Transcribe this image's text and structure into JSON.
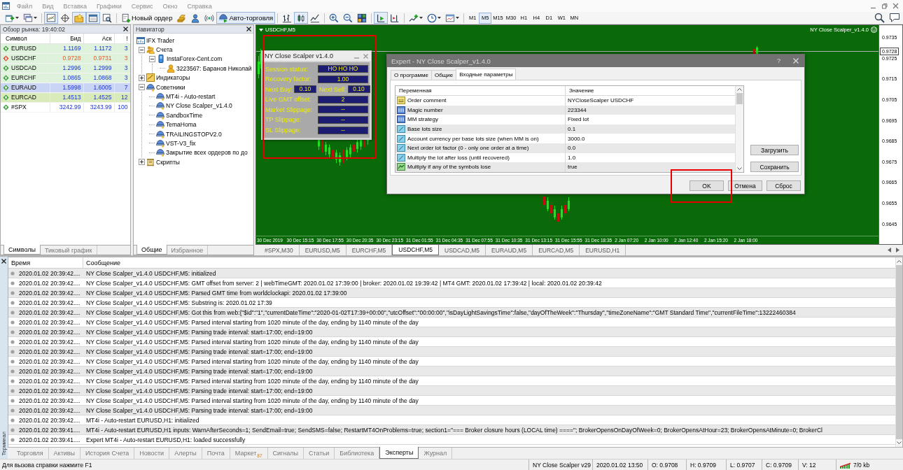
{
  "menu": [
    "Файл",
    "Вид",
    "Вставка",
    "Графики",
    "Сервис",
    "Окно",
    "Справка"
  ],
  "toolbar": {
    "items": [
      {
        "kind": "icon",
        "pressed": false
      },
      {
        "kind": "icon",
        "pressed": false
      },
      {
        "kind": "separator"
      },
      {
        "kind": "icon",
        "pressed": true
      },
      {
        "kind": "icon",
        "pressed": false
      },
      {
        "kind": "icon",
        "pressed": true
      },
      {
        "kind": "icon",
        "pressed": true
      },
      {
        "kind": "icon",
        "pressed": false
      },
      {
        "kind": "separator"
      },
      {
        "kind": "button",
        "label": "Новый ордер"
      },
      {
        "kind": "icon",
        "pressed": false
      },
      {
        "kind": "icon",
        "pressed": false
      },
      {
        "kind": "icon",
        "pressed": false
      },
      {
        "kind": "toggle",
        "label": "Авто-торговля",
        "on": true
      },
      {
        "kind": "separator"
      },
      {
        "kind": "icon",
        "pressed": false
      },
      {
        "kind": "icon",
        "pressed": true
      },
      {
        "kind": "icon",
        "pressed": false
      },
      {
        "kind": "separator"
      },
      {
        "kind": "icon",
        "pressed": false
      },
      {
        "kind": "icon",
        "pressed": false
      },
      {
        "kind": "icon",
        "pressed": false
      },
      {
        "kind": "separator"
      },
      {
        "kind": "icon",
        "pressed": true
      },
      {
        "kind": "icon",
        "pressed": false
      },
      {
        "kind": "separator"
      },
      {
        "kind": "icon",
        "pressed": false
      },
      {
        "kind": "icon",
        "pressed": false
      },
      {
        "kind": "icon",
        "pressed": false
      },
      {
        "kind": "separator"
      },
      {
        "kind": "timeframe",
        "label": "M1",
        "selected": false
      },
      {
        "kind": "timeframe",
        "label": "M5",
        "selected": true
      },
      {
        "kind": "timeframe",
        "label": "M15",
        "selected": false
      },
      {
        "kind": "timeframe",
        "label": "M30",
        "selected": false
      },
      {
        "kind": "timeframe",
        "label": "H1",
        "selected": false
      },
      {
        "kind": "timeframe",
        "label": "H4",
        "selected": false
      },
      {
        "kind": "timeframe",
        "label": "D1",
        "selected": false
      },
      {
        "kind": "timeframe",
        "label": "W1",
        "selected": false
      },
      {
        "kind": "timeframe",
        "label": "MN",
        "selected": false
      }
    ]
  },
  "market_watch": {
    "title": "Обзор рынка: 19:40:02",
    "columns": [
      "Символ",
      "Бид",
      "Аск",
      "!"
    ],
    "rows": [
      {
        "symbol": "EURUSD",
        "bid": "1.1169",
        "ask": "1.1172",
        "spread": "3",
        "falling": false,
        "color": "#dff2dc"
      },
      {
        "symbol": "USDCHF",
        "bid": "0.9728",
        "ask": "0.9731",
        "spread": "3",
        "falling": true,
        "color": "#dff2dc"
      },
      {
        "symbol": "USDCAD",
        "bid": "1.2996",
        "ask": "1.2999",
        "spread": "3",
        "falling": false,
        "color": "#dff2dc"
      },
      {
        "symbol": "EURCHF",
        "bid": "1.0865",
        "ask": "1.0868",
        "spread": "3",
        "falling": false,
        "color": "#dff2dc"
      },
      {
        "symbol": "EURAUD",
        "bid": "1.5998",
        "ask": "1.6005",
        "spread": "7",
        "falling": false,
        "color": "#cad4f5"
      },
      {
        "symbol": "EURCAD",
        "bid": "1.4513",
        "ask": "1.4525",
        "spread": "12",
        "falling": false,
        "color": "#d9eabb"
      },
      {
        "symbol": "#SPX",
        "bid": "3242.99",
        "ask": "3243.99",
        "spread": "100",
        "falling": false,
        "color": "#ffffff"
      }
    ],
    "tabs": [
      {
        "label": "Символы",
        "selected": true
      },
      {
        "label": "Тиковый график",
        "selected": false
      }
    ]
  },
  "navigator": {
    "title": "Навигатор",
    "tree": [
      {
        "label": "IFX Trader",
        "kind": "root",
        "children": [
          {
            "label": "Счета",
            "kind": "accounts",
            "expanded": true,
            "children": [
              {
                "label": "InstaForex-Cent.com",
                "kind": "server",
                "expanded": true,
                "children": [
                  {
                    "label": "3223567: Баранов Николай",
                    "kind": "account"
                  }
                ]
              }
            ]
          },
          {
            "label": "Индикаторы",
            "kind": "indicators",
            "expanded": false
          },
          {
            "label": "Советники",
            "kind": "experts",
            "expanded": true,
            "children": [
              {
                "label": "MT4i - Auto-restart",
                "kind": "expert"
              },
              {
                "label": "NY Close Scalper_v1.4.0",
                "kind": "expert"
              },
              {
                "label": "SandboxTime",
                "kind": "expert"
              },
              {
                "label": "TemaHoma",
                "kind": "expert"
              },
              {
                "label": "TRAILINGSTOPV2.0",
                "kind": "expert"
              },
              {
                "label": "VST-V3_fix",
                "kind": "expert"
              },
              {
                "label": "Закрытие всех ордеров по до",
                "kind": "expert"
              }
            ]
          },
          {
            "label": "Скрипты",
            "kind": "scripts",
            "expanded": false
          }
        ]
      }
    ],
    "tabs": [
      {
        "label": "Общие",
        "selected": true
      },
      {
        "label": "Избранное",
        "selected": false
      }
    ]
  },
  "chart": {
    "title": "USDCHF,M5",
    "expert": "NY Close Scalper_v1.4.0",
    "current_price": "0.9728",
    "price_axis": [
      "0.9735",
      "0.9725",
      "0.9715",
      "0.9705",
      "0.9695",
      "0.9685",
      "0.9675",
      "0.9665",
      "0.9655",
      "0.9645"
    ],
    "time_axis": [
      "30 Dec 2019",
      "30 Dec 15:15",
      "30 Dec 17:55",
      "30 Dec 20:35",
      "30 Dec 23:15",
      "31 Dec 01:55",
      "31 Dec 04:35",
      "31 Dec 07:55",
      "31 Dec 10:35",
      "31 Dec 13:15",
      "31 Dec 15:55",
      "31 Dec 18:35",
      "2 Jan 07:20",
      "2 Jan 10:00",
      "2 Jan 12:40",
      "2 Jan 15:20",
      "2 Jan 18:00"
    ],
    "tabs": [
      {
        "label": "#SPX,M30",
        "selected": false
      },
      {
        "label": "EURUSD,M5",
        "selected": false
      },
      {
        "label": "EURCHF,M5",
        "selected": false
      },
      {
        "label": "USDCHF,M5",
        "selected": true
      },
      {
        "label": "USDCAD,M5",
        "selected": false
      },
      {
        "label": "EURAUD,M5",
        "selected": false
      },
      {
        "label": "EURCAD,M5",
        "selected": false
      },
      {
        "label": "EURUSD,H1",
        "selected": false
      }
    ]
  },
  "ea_panel": {
    "title": "NY Close Scalper v1.4.0",
    "rows": [
      [
        {
          "label": "Session status:",
          "value": "HO HO HO"
        }
      ],
      [
        {
          "label": "Recovery factor:",
          "value": "1.00"
        }
      ],
      [
        {
          "label": "Next Buy:",
          "value": "0.10"
        },
        {
          "label": "Next Sell:",
          "value": "0.10"
        }
      ],
      [
        {
          "label": "Live GMT offset:",
          "value": "2"
        }
      ],
      [
        {
          "label": "Market Slippage:",
          "value": "--"
        }
      ],
      [
        {
          "label": "TP Slippage:",
          "value": "--"
        }
      ],
      [
        {
          "label": "SL Slippage:",
          "value": "--"
        }
      ]
    ]
  },
  "expert_dialog": {
    "title": "Expert - NY Close Scalper_v1.4.0",
    "help": "?",
    "tabs": [
      {
        "label": "О программе",
        "selected": false
      },
      {
        "label": "Общие",
        "selected": false
      },
      {
        "label": "Входные параметры",
        "selected": true
      }
    ],
    "columns": [
      "Переменная",
      "Значение"
    ],
    "params": [
      {
        "name": "Order comment",
        "value": "NYCloseScalper USDCHF",
        "kind": "string"
      },
      {
        "name": "Magic number",
        "value": "223344",
        "kind": "int"
      },
      {
        "name": "MM strategy",
        "value": "Fixed lot",
        "kind": "int"
      },
      {
        "name": "Base lots size",
        "value": "0.1",
        "kind": "double"
      },
      {
        "name": "Account currency per base lots size (when MM is on)",
        "value": "3000.0",
        "kind": "double"
      },
      {
        "name": "Next order lot factor (0 - only one order at a time)",
        "value": "0.0",
        "kind": "double"
      },
      {
        "name": "Multiply the lot after loss (until recovered)",
        "value": "1.0",
        "kind": "double"
      },
      {
        "name": "Multiply if any of the symbols lose",
        "value": "true",
        "kind": "bool"
      }
    ],
    "side_buttons": [
      "Загрузить",
      "Сохранить"
    ],
    "buttons": [
      "OK",
      "Отмена",
      "Сброс"
    ]
  },
  "terminal": {
    "title": "Терминал",
    "columns": [
      "Время",
      "Сообщение"
    ],
    "log": [
      {
        "time": "2020.01.02 20:39:42....",
        "message": "NY Close Scalper_v1.4.0 USDCHF,M5: initialized"
      },
      {
        "time": "2020.01.02 20:39:42....",
        "message": "NY Close Scalper_v1.4.0 USDCHF,M5: GMT offset from server: 2 | webTimeGMT: 2020.01.02 17:39:00 | broker: 2020.01.02 19:39:42 | MT4 GMT: 2020.01.02 17:39:42 | local: 2020.01.02 20:39:42"
      },
      {
        "time": "2020.01.02 20:39:42....",
        "message": "NY Close Scalper_v1.4.0 USDCHF,M5: Parsed GMT time from worldclockapi: 2020.01.02 17:39:00"
      },
      {
        "time": "2020.01.02 20:39:42....",
        "message": "NY Close Scalper_v1.4.0 USDCHF,M5: Substring is: 2020.01.02 17:39"
      },
      {
        "time": "2020.01.02 20:39:42....",
        "message": "NY Close Scalper_v1.4.0 USDCHF,M5: Got this from web:{\"$id\":\"1\",\"currentDateTime\":\"2020-01-02T17:39+00:00\",\"utcOffset\":\"00:00:00\",\"isDayLightSavingsTime\":false,\"dayOfTheWeek\":\"Thursday\",\"timeZoneName\":\"GMT Standard Time\",\"currentFileTime\":13222460384"
      },
      {
        "time": "2020.01.02 20:39:42....",
        "message": "NY Close Scalper_v1.4.0 USDCHF,M5: Parsed interval starting from 1020 minute of the day, ending by 1140 minute of the day"
      },
      {
        "time": "2020.01.02 20:39:42....",
        "message": "NY Close Scalper_v1.4.0 USDCHF,M5: Parsing trade interval: start=17:00; end=19:00"
      },
      {
        "time": "2020.01.02 20:39:42....",
        "message": "NY Close Scalper_v1.4.0 USDCHF,M5: Parsed interval starting from 1020 minute of the day, ending by 1140 minute of the day"
      },
      {
        "time": "2020.01.02 20:39:42....",
        "message": "NY Close Scalper_v1.4.0 USDCHF,M5: Parsing trade interval: start=17:00; end=19:00"
      },
      {
        "time": "2020.01.02 20:39:42....",
        "message": "NY Close Scalper_v1.4.0 USDCHF,M5: Parsed interval starting from 1020 minute of the day, ending by 1140 minute of the day"
      },
      {
        "time": "2020.01.02 20:39:42....",
        "message": "NY Close Scalper_v1.4.0 USDCHF,M5: Parsing trade interval: start=17:00; end=19:00"
      },
      {
        "time": "2020.01.02 20:39:42....",
        "message": "NY Close Scalper_v1.4.0 USDCHF,M5: Parsed interval starting from 1020 minute of the day, ending by 1140 minute of the day"
      },
      {
        "time": "2020.01.02 20:39:42....",
        "message": "NY Close Scalper_v1.4.0 USDCHF,M5: Parsing trade interval: start=17:00; end=19:00"
      },
      {
        "time": "2020.01.02 20:39:42....",
        "message": "NY Close Scalper_v1.4.0 USDCHF,M5: Parsed interval starting from 1020 minute of the day, ending by 1140 minute of the day"
      },
      {
        "time": "2020.01.02 20:39:42....",
        "message": "NY Close Scalper_v1.4.0 USDCHF,M5: Parsing trade interval: start=17:00; end=19:00"
      },
      {
        "time": "2020.01.02 20:39:42....",
        "message": "MT4i - Auto-restart EURUSD,H1: initialized"
      },
      {
        "time": "2020.01.02 20:39:41....",
        "message": "MT4i - Auto-restart EURUSD,H1 inputs: WarnAfterSeconds=1; SendEmail=true; SendSMS=false; RestartMT4OnProblems=true; section1=\"=== Broker closure hours (LOCAL time) ====\"; BrokerOpensOnDayOfWeek=0; BrokerOpensAtHour=23; BrokerOpensAtMinute=0; BrokerCl"
      },
      {
        "time": "2020.01.02 20:39:41....",
        "message": "Expert MT4i - Auto-restart EURUSD,H1: loaded successfully"
      }
    ],
    "tabs": [
      {
        "label": "Торговля",
        "selected": false
      },
      {
        "label": "Активы",
        "selected": false
      },
      {
        "label": "История Счета",
        "selected": false
      },
      {
        "label": "Новости",
        "selected": false
      },
      {
        "label": "Алерты",
        "selected": false
      },
      {
        "label": "Почта",
        "selected": false
      },
      {
        "label": "Маркет",
        "badge": "87",
        "selected": false
      },
      {
        "label": "Сигналы",
        "selected": false
      },
      {
        "label": "Статьи",
        "selected": false
      },
      {
        "label": "Библиотека",
        "selected": false
      },
      {
        "label": "Эксперты",
        "selected": true
      },
      {
        "label": "Журнал",
        "selected": false
      }
    ]
  },
  "status_bar": {
    "help": "Для вызова справки нажмите F1",
    "fields": [
      "NY Close Scalper v29",
      "2020.01.02 13:50",
      "O: 0.9708",
      "H: 0.9709",
      "L: 0.9707",
      "C: 0.9709",
      "V: 12"
    ],
    "traffic": "7/0 kb"
  }
}
